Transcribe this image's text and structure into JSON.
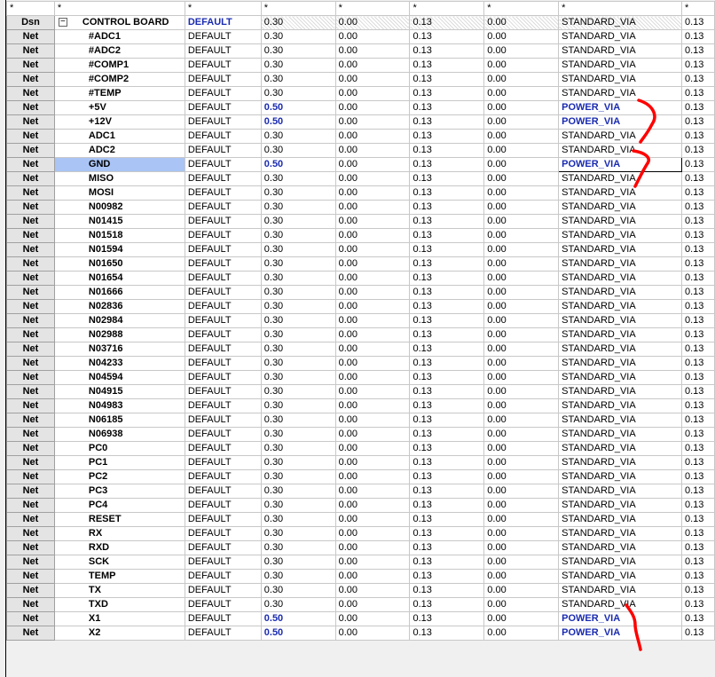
{
  "header": [
    "*",
    "*",
    "*",
    "*",
    "*",
    "*",
    "*",
    "*",
    "*"
  ],
  "colors": {
    "blue_value": "#1a2bb0",
    "selected": "#a9c4f5",
    "annotation": "#ff0000"
  },
  "rows": [
    {
      "kind": "Dsn",
      "name": "CONTROL BOARD",
      "type": "DEFAULT",
      "v1": "0.30",
      "v2": "0.00",
      "v3": "0.13",
      "v4": "0.00",
      "via": "STANDARD_VIA",
      "last": "0.13",
      "tree": "−"
    },
    {
      "kind": "Net",
      "name": "#ADC1",
      "type": "DEFAULT",
      "v1": "0.30",
      "v2": "0.00",
      "v3": "0.13",
      "v4": "0.00",
      "via": "STANDARD_VIA",
      "last": "0.13"
    },
    {
      "kind": "Net",
      "name": "#ADC2",
      "type": "DEFAULT",
      "v1": "0.30",
      "v2": "0.00",
      "v3": "0.13",
      "v4": "0.00",
      "via": "STANDARD_VIA",
      "last": "0.13"
    },
    {
      "kind": "Net",
      "name": "#COMP1",
      "type": "DEFAULT",
      "v1": "0.30",
      "v2": "0.00",
      "v3": "0.13",
      "v4": "0.00",
      "via": "STANDARD_VIA",
      "last": "0.13"
    },
    {
      "kind": "Net",
      "name": "#COMP2",
      "type": "DEFAULT",
      "v1": "0.30",
      "v2": "0.00",
      "v3": "0.13",
      "v4": "0.00",
      "via": "STANDARD_VIA",
      "last": "0.13"
    },
    {
      "kind": "Net",
      "name": "#TEMP",
      "type": "DEFAULT",
      "v1": "0.30",
      "v2": "0.00",
      "v3": "0.13",
      "v4": "0.00",
      "via": "STANDARD_VIA",
      "last": "0.13"
    },
    {
      "kind": "Net",
      "name": "+5V",
      "type": "DEFAULT",
      "v1": "0.50",
      "v2": "0.00",
      "v3": "0.13",
      "v4": "0.00",
      "via": "POWER_VIA",
      "last": "0.13"
    },
    {
      "kind": "Net",
      "name": "+12V",
      "type": "DEFAULT",
      "v1": "0.50",
      "v2": "0.00",
      "v3": "0.13",
      "v4": "0.00",
      "via": "POWER_VIA",
      "last": "0.13"
    },
    {
      "kind": "Net",
      "name": "ADC1",
      "type": "DEFAULT",
      "v1": "0.30",
      "v2": "0.00",
      "v3": "0.13",
      "v4": "0.00",
      "via": "STANDARD_VIA",
      "last": "0.13"
    },
    {
      "kind": "Net",
      "name": "ADC2",
      "type": "DEFAULT",
      "v1": "0.30",
      "v2": "0.00",
      "v3": "0.13",
      "v4": "0.00",
      "via": "STANDARD_VIA",
      "last": "0.13"
    },
    {
      "kind": "Net",
      "name": "GND",
      "type": "DEFAULT",
      "v1": "0.50",
      "v2": "0.00",
      "v3": "0.13",
      "v4": "0.00",
      "via": "POWER_VIA",
      "last": "0.13",
      "selected": true
    },
    {
      "kind": "Net",
      "name": "MISO",
      "type": "DEFAULT",
      "v1": "0.30",
      "v2": "0.00",
      "v3": "0.13",
      "v4": "0.00",
      "via": "STANDARD_VIA",
      "last": "0.13"
    },
    {
      "kind": "Net",
      "name": "MOSI",
      "type": "DEFAULT",
      "v1": "0.30",
      "v2": "0.00",
      "v3": "0.13",
      "v4": "0.00",
      "via": "STANDARD_VIA",
      "last": "0.13"
    },
    {
      "kind": "Net",
      "name": "N00982",
      "type": "DEFAULT",
      "v1": "0.30",
      "v2": "0.00",
      "v3": "0.13",
      "v4": "0.00",
      "via": "STANDARD_VIA",
      "last": "0.13"
    },
    {
      "kind": "Net",
      "name": "N01415",
      "type": "DEFAULT",
      "v1": "0.30",
      "v2": "0.00",
      "v3": "0.13",
      "v4": "0.00",
      "via": "STANDARD_VIA",
      "last": "0.13"
    },
    {
      "kind": "Net",
      "name": "N01518",
      "type": "DEFAULT",
      "v1": "0.30",
      "v2": "0.00",
      "v3": "0.13",
      "v4": "0.00",
      "via": "STANDARD_VIA",
      "last": "0.13"
    },
    {
      "kind": "Net",
      "name": "N01594",
      "type": "DEFAULT",
      "v1": "0.30",
      "v2": "0.00",
      "v3": "0.13",
      "v4": "0.00",
      "via": "STANDARD_VIA",
      "last": "0.13"
    },
    {
      "kind": "Net",
      "name": "N01650",
      "type": "DEFAULT",
      "v1": "0.30",
      "v2": "0.00",
      "v3": "0.13",
      "v4": "0.00",
      "via": "STANDARD_VIA",
      "last": "0.13"
    },
    {
      "kind": "Net",
      "name": "N01654",
      "type": "DEFAULT",
      "v1": "0.30",
      "v2": "0.00",
      "v3": "0.13",
      "v4": "0.00",
      "via": "STANDARD_VIA",
      "last": "0.13"
    },
    {
      "kind": "Net",
      "name": "N01666",
      "type": "DEFAULT",
      "v1": "0.30",
      "v2": "0.00",
      "v3": "0.13",
      "v4": "0.00",
      "via": "STANDARD_VIA",
      "last": "0.13"
    },
    {
      "kind": "Net",
      "name": "N02836",
      "type": "DEFAULT",
      "v1": "0.30",
      "v2": "0.00",
      "v3": "0.13",
      "v4": "0.00",
      "via": "STANDARD_VIA",
      "last": "0.13"
    },
    {
      "kind": "Net",
      "name": "N02984",
      "type": "DEFAULT",
      "v1": "0.30",
      "v2": "0.00",
      "v3": "0.13",
      "v4": "0.00",
      "via": "STANDARD_VIA",
      "last": "0.13"
    },
    {
      "kind": "Net",
      "name": "N02988",
      "type": "DEFAULT",
      "v1": "0.30",
      "v2": "0.00",
      "v3": "0.13",
      "v4": "0.00",
      "via": "STANDARD_VIA",
      "last": "0.13"
    },
    {
      "kind": "Net",
      "name": "N03716",
      "type": "DEFAULT",
      "v1": "0.30",
      "v2": "0.00",
      "v3": "0.13",
      "v4": "0.00",
      "via": "STANDARD_VIA",
      "last": "0.13"
    },
    {
      "kind": "Net",
      "name": "N04233",
      "type": "DEFAULT",
      "v1": "0.30",
      "v2": "0.00",
      "v3": "0.13",
      "v4": "0.00",
      "via": "STANDARD_VIA",
      "last": "0.13"
    },
    {
      "kind": "Net",
      "name": "N04594",
      "type": "DEFAULT",
      "v1": "0.30",
      "v2": "0.00",
      "v3": "0.13",
      "v4": "0.00",
      "via": "STANDARD_VIA",
      "last": "0.13"
    },
    {
      "kind": "Net",
      "name": "N04915",
      "type": "DEFAULT",
      "v1": "0.30",
      "v2": "0.00",
      "v3": "0.13",
      "v4": "0.00",
      "via": "STANDARD_VIA",
      "last": "0.13"
    },
    {
      "kind": "Net",
      "name": "N04983",
      "type": "DEFAULT",
      "v1": "0.30",
      "v2": "0.00",
      "v3": "0.13",
      "v4": "0.00",
      "via": "STANDARD_VIA",
      "last": "0.13"
    },
    {
      "kind": "Net",
      "name": "N06185",
      "type": "DEFAULT",
      "v1": "0.30",
      "v2": "0.00",
      "v3": "0.13",
      "v4": "0.00",
      "via": "STANDARD_VIA",
      "last": "0.13"
    },
    {
      "kind": "Net",
      "name": "N06938",
      "type": "DEFAULT",
      "v1": "0.30",
      "v2": "0.00",
      "v3": "0.13",
      "v4": "0.00",
      "via": "STANDARD_VIA",
      "last": "0.13"
    },
    {
      "kind": "Net",
      "name": "PC0",
      "type": "DEFAULT",
      "v1": "0.30",
      "v2": "0.00",
      "v3": "0.13",
      "v4": "0.00",
      "via": "STANDARD_VIA",
      "last": "0.13"
    },
    {
      "kind": "Net",
      "name": "PC1",
      "type": "DEFAULT",
      "v1": "0.30",
      "v2": "0.00",
      "v3": "0.13",
      "v4": "0.00",
      "via": "STANDARD_VIA",
      "last": "0.13"
    },
    {
      "kind": "Net",
      "name": "PC2",
      "type": "DEFAULT",
      "v1": "0.30",
      "v2": "0.00",
      "v3": "0.13",
      "v4": "0.00",
      "via": "STANDARD_VIA",
      "last": "0.13"
    },
    {
      "kind": "Net",
      "name": "PC3",
      "type": "DEFAULT",
      "v1": "0.30",
      "v2": "0.00",
      "v3": "0.13",
      "v4": "0.00",
      "via": "STANDARD_VIA",
      "last": "0.13"
    },
    {
      "kind": "Net",
      "name": "PC4",
      "type": "DEFAULT",
      "v1": "0.30",
      "v2": "0.00",
      "v3": "0.13",
      "v4": "0.00",
      "via": "STANDARD_VIA",
      "last": "0.13"
    },
    {
      "kind": "Net",
      "name": "RESET",
      "type": "DEFAULT",
      "v1": "0.30",
      "v2": "0.00",
      "v3": "0.13",
      "v4": "0.00",
      "via": "STANDARD_VIA",
      "last": "0.13"
    },
    {
      "kind": "Net",
      "name": "RX",
      "type": "DEFAULT",
      "v1": "0.30",
      "v2": "0.00",
      "v3": "0.13",
      "v4": "0.00",
      "via": "STANDARD_VIA",
      "last": "0.13"
    },
    {
      "kind": "Net",
      "name": "RXD",
      "type": "DEFAULT",
      "v1": "0.30",
      "v2": "0.00",
      "v3": "0.13",
      "v4": "0.00",
      "via": "STANDARD_VIA",
      "last": "0.13"
    },
    {
      "kind": "Net",
      "name": "SCK",
      "type": "DEFAULT",
      "v1": "0.30",
      "v2": "0.00",
      "v3": "0.13",
      "v4": "0.00",
      "via": "STANDARD_VIA",
      "last": "0.13"
    },
    {
      "kind": "Net",
      "name": "TEMP",
      "type": "DEFAULT",
      "v1": "0.30",
      "v2": "0.00",
      "v3": "0.13",
      "v4": "0.00",
      "via": "STANDARD_VIA",
      "last": "0.13"
    },
    {
      "kind": "Net",
      "name": "TX",
      "type": "DEFAULT",
      "v1": "0.30",
      "v2": "0.00",
      "v3": "0.13",
      "v4": "0.00",
      "via": "STANDARD_VIA",
      "last": "0.13"
    },
    {
      "kind": "Net",
      "name": "TXD",
      "type": "DEFAULT",
      "v1": "0.30",
      "v2": "0.00",
      "v3": "0.13",
      "v4": "0.00",
      "via": "STANDARD_VIA",
      "last": "0.13"
    },
    {
      "kind": "Net",
      "name": "X1",
      "type": "DEFAULT",
      "v1": "0.50",
      "v2": "0.00",
      "v3": "0.13",
      "v4": "0.00",
      "via": "POWER_VIA",
      "last": "0.13"
    },
    {
      "kind": "Net",
      "name": "X2",
      "type": "DEFAULT",
      "v1": "0.50",
      "v2": "0.00",
      "v3": "0.13",
      "v4": "0.00",
      "via": "POWER_VIA",
      "last": "0.13"
    }
  ]
}
